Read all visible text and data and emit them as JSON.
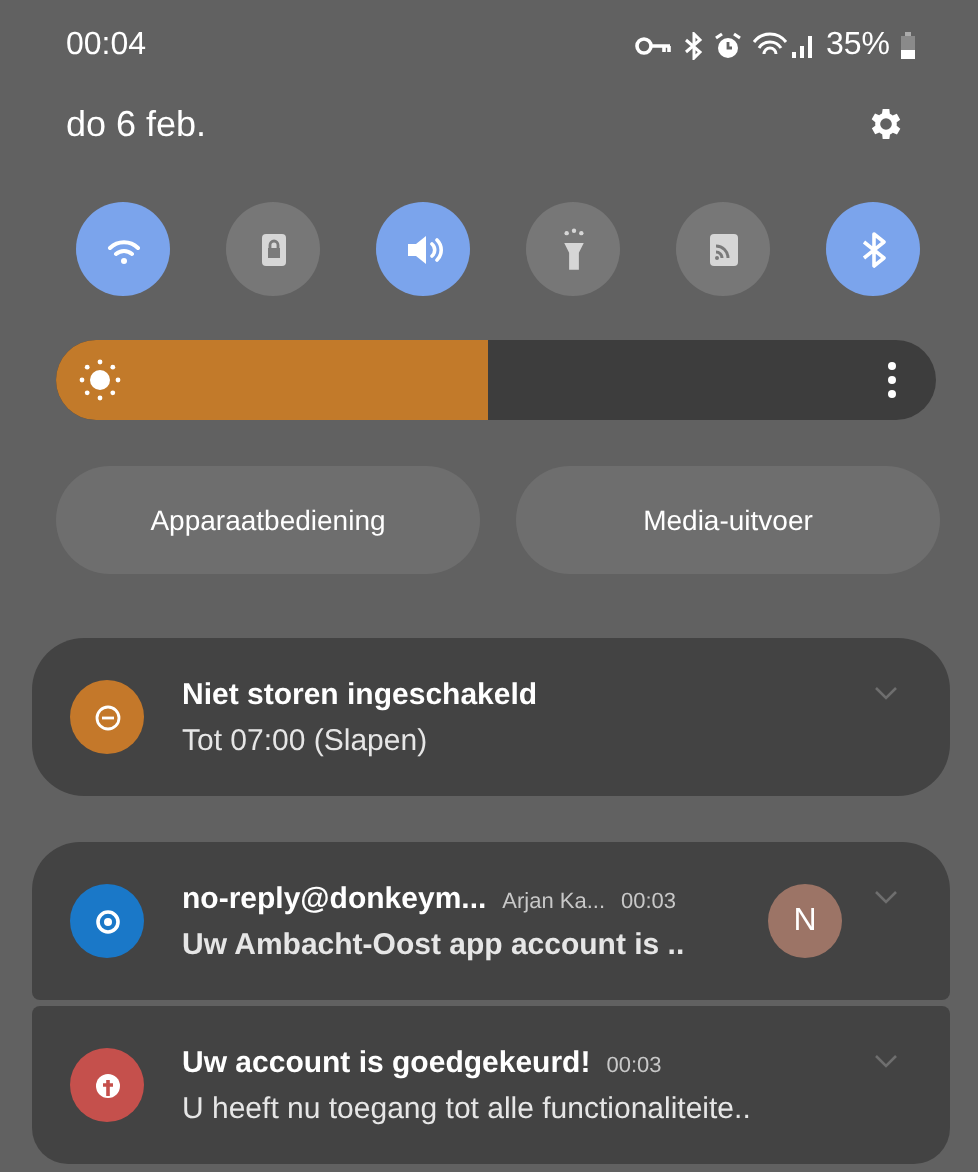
{
  "status_bar": {
    "time": "00:04",
    "battery": "35%"
  },
  "header": {
    "date": "do 6 feb."
  },
  "quick_toggles": [
    {
      "on": true
    },
    {
      "on": false
    },
    {
      "on": true
    },
    {
      "on": false
    },
    {
      "on": false
    },
    {
      "on": true
    }
  ],
  "brightness": {
    "level": 0.49
  },
  "buttons": [
    "Apparaatbediening",
    "Media-uitvoer"
  ],
  "notifications": [
    {
      "title": "Niet storen ingeschakeld",
      "text": "Tot 07:00 (Slapen)",
      "color": "#c4782a",
      "group_start": true
    },
    {
      "title": "no-reply@donkeym...",
      "sender": "Arjan Ka...",
      "time": "00:03",
      "text": "Uw Ambacht-Oost app account is ..",
      "bold_text": true,
      "avatar": "N",
      "color": "#1a78c8",
      "group_start": true
    },
    {
      "title": "Uw account is goedgekeurd!",
      "time": "00:03",
      "text": "U heeft nu toegang tot alle functionaliteite..",
      "color": "#c5504c",
      "group_start": false
    }
  ]
}
